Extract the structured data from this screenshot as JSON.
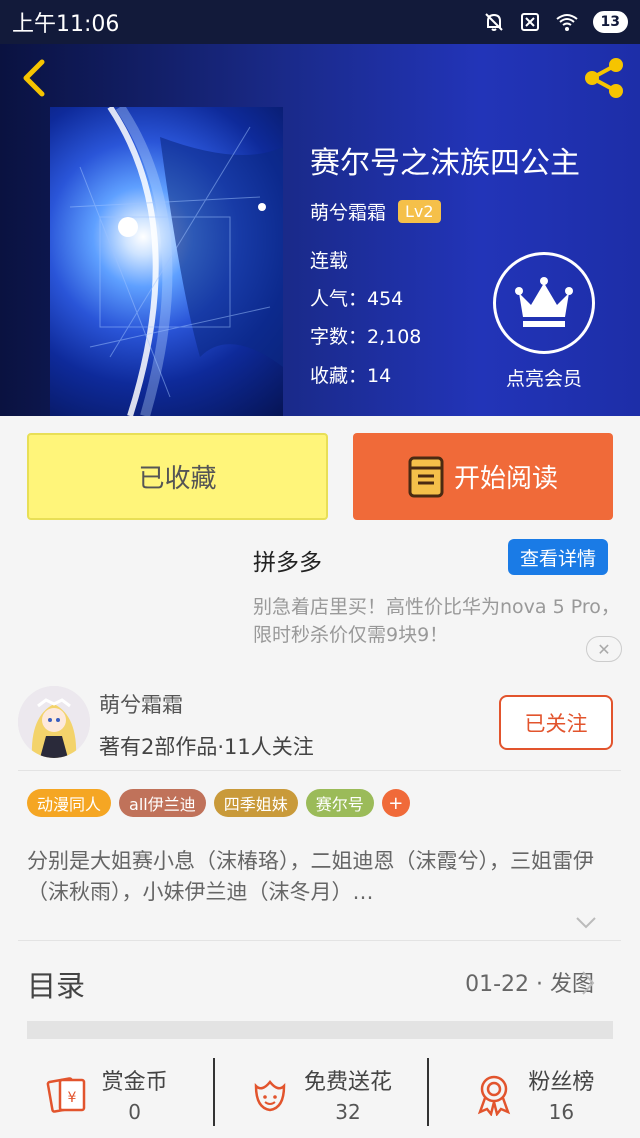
{
  "status_bar": {
    "time": "上午11:06",
    "battery": "13"
  },
  "book": {
    "title": "赛尔号之沫族四公主",
    "author": "萌兮霜霜",
    "level": "Lv2",
    "status": "连载",
    "popularity": "人气：454",
    "word_count": "字数：2,108",
    "collections": "收藏：14"
  },
  "vip": {
    "label": "点亮会员"
  },
  "actions": {
    "collected": "已收藏",
    "start_reading": "开始阅读"
  },
  "ad": {
    "title": "拼多多",
    "button": "查看详情",
    "text": "别急着店里买！高性价比华为nova 5 Pro，限时秒杀价仅需9块9！",
    "close": "✕"
  },
  "author_card": {
    "name": "萌兮霜霜",
    "summary": "著有2部作品·11人关注",
    "follow": "已关注"
  },
  "tags": [
    {
      "label": "动漫同人",
      "color": "#f5a623"
    },
    {
      "label": "all伊兰迪",
      "color": "#c0725a"
    },
    {
      "label": "四季姐妹",
      "color": "#c99a3a"
    },
    {
      "label": "赛尔号",
      "color": "#9bbb59"
    }
  ],
  "tag_add": "+",
  "description": "分别是大姐赛小息（沫椿珞），二姐迪恩（沫霞兮），三姐雷伊（沫秋雨），小妹伊兰迪（沫冬月）…",
  "toc": {
    "label": "目录",
    "latest": "01-22 · 发图"
  },
  "stats": [
    {
      "label": "赏金币",
      "value": "0",
      "icon": "coin-envelope-icon"
    },
    {
      "label": "免费送花",
      "value": "32",
      "icon": "flower-icon"
    },
    {
      "label": "粉丝榜",
      "value": "16",
      "icon": "ribbon-medal-icon"
    }
  ],
  "colors": {
    "accent": "#f06a39",
    "header": "#1a2a8a",
    "collect": "#fff57a",
    "blue_button": "#1a7be6"
  }
}
